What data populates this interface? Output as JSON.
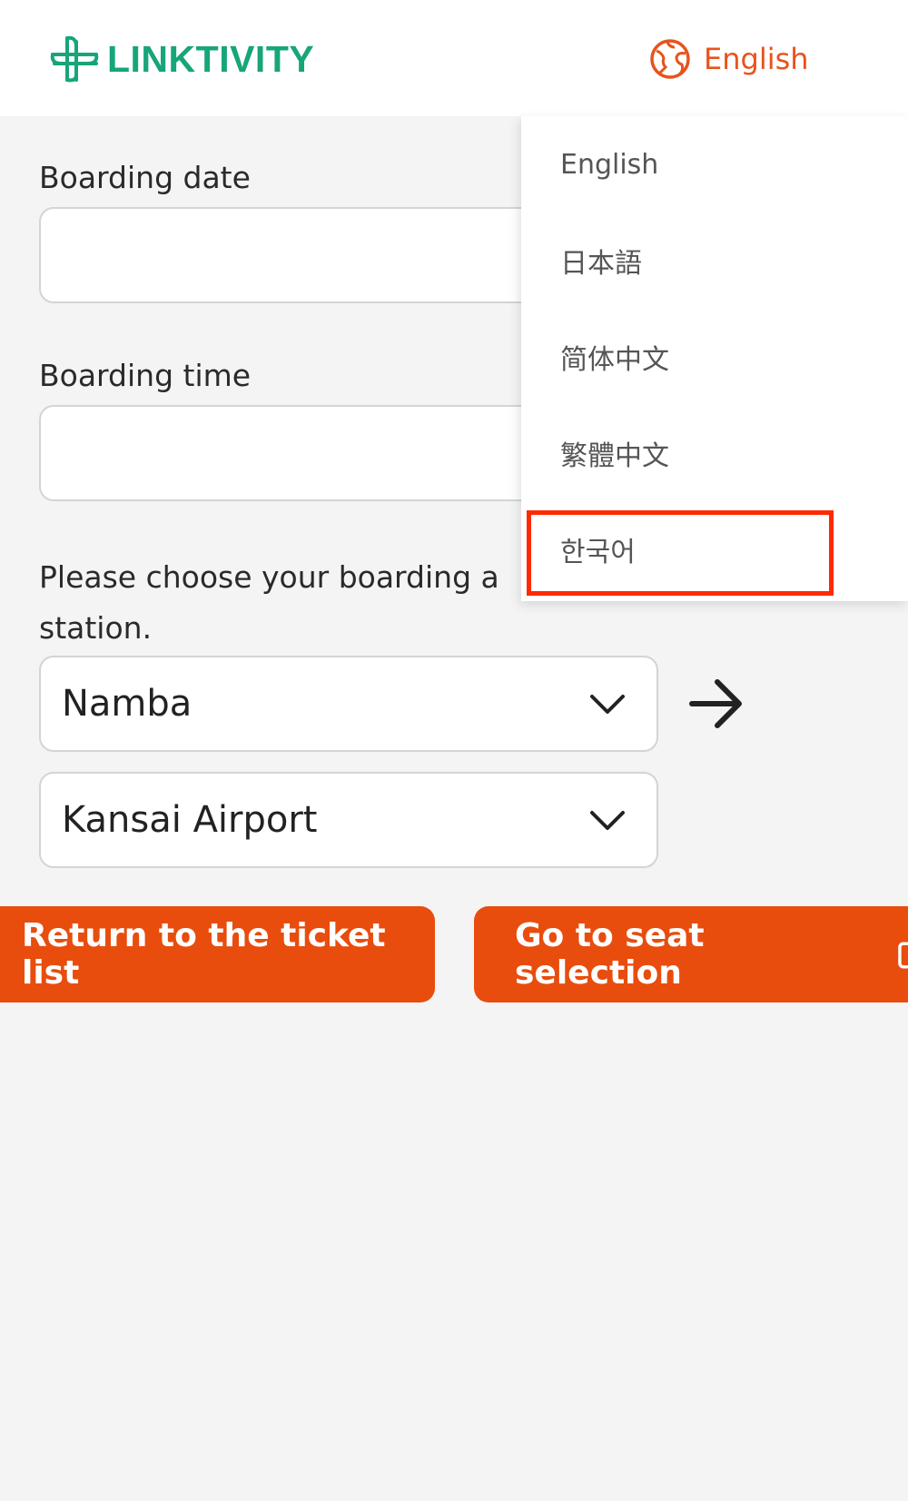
{
  "header": {
    "logo_text": "LINKTIVITY",
    "language_button_label": "English",
    "brand_color": "#17a57a",
    "accent_color": "#e8531c"
  },
  "form": {
    "boarding_date_label": "Boarding date",
    "boarding_date_value": "",
    "boarding_time_label": "Boarding time",
    "boarding_time_value": "",
    "station_prompt": "Please choose your boarding a\nstation.",
    "departure_station": "Namba",
    "arrival_station": "Kansai Airport"
  },
  "buttons": {
    "return_label": "Return to the ticket list",
    "seat_label": "Go to seat selection"
  },
  "language_menu": {
    "items": [
      {
        "label": "English"
      },
      {
        "label": "日本語"
      },
      {
        "label": "简体中文"
      },
      {
        "label": "繁體中文"
      },
      {
        "label": "한국어"
      }
    ],
    "highlighted_item": "한국어",
    "highlight_color": "#ff2a00"
  },
  "icons": {
    "logo": "linktivity-logo-icon",
    "language": "globe-icon",
    "select": "chevron-down-icon",
    "swap": "arrow-right-icon",
    "external": "external-link-icon"
  }
}
